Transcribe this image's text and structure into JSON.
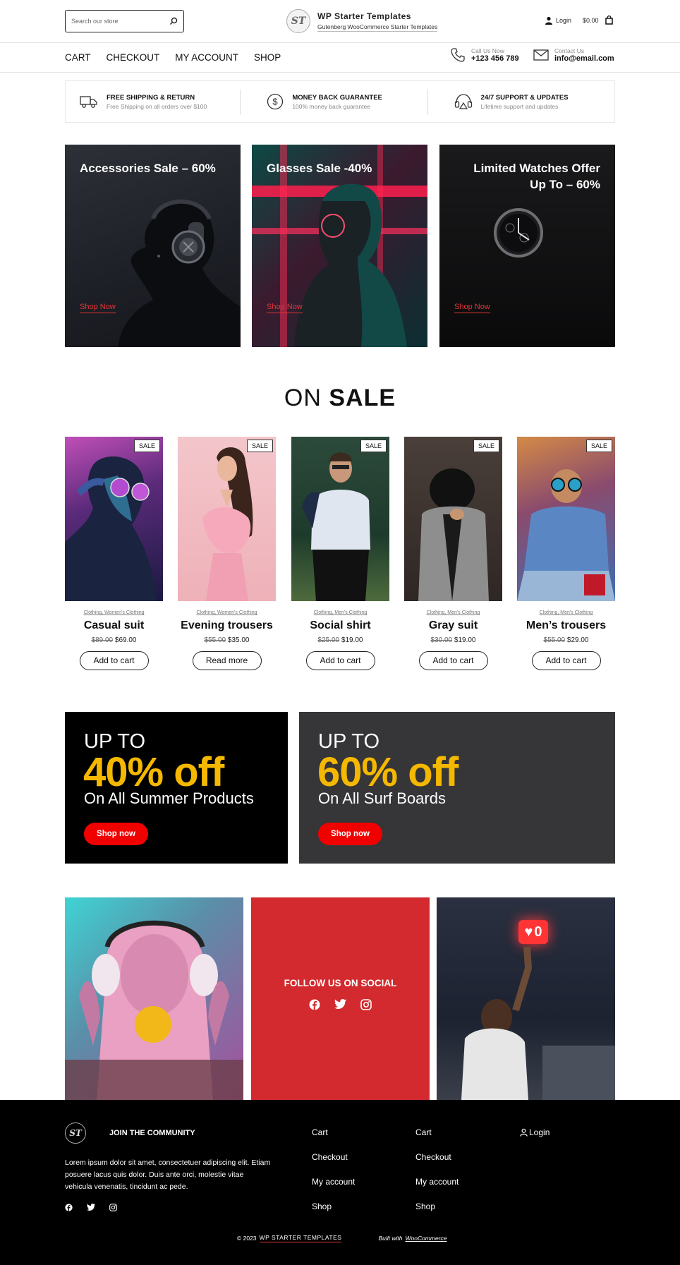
{
  "header": {
    "search_placeholder": "Search our store",
    "brand_title": "WP Starter Templates",
    "brand_subtitle": "Gutenberg WooCommerce Starter Templates",
    "logo_text": "ST",
    "login_label": "Login",
    "cart_total": "$0.00"
  },
  "nav": {
    "items": [
      "CART",
      "CHECKOUT",
      "MY ACCOUNT",
      "SHOP"
    ]
  },
  "contact": {
    "call_label": "Call Us Now",
    "phone": "+123 456 789",
    "mail_label": "Contact Us",
    "email": "info@email.com"
  },
  "features": [
    {
      "title": "FREE SHIPPING & RETURN",
      "sub": "Free Shipping on all orders over $100",
      "icon": "truck-icon"
    },
    {
      "title": "MONEY BACK GUARANTEE",
      "sub": "100% money back guarantee",
      "icon": "dollar-icon"
    },
    {
      "title": "24/7 SUPPORT & UPDATES",
      "sub": "Lifetime support and updates",
      "icon": "support-icon"
    }
  ],
  "banners": [
    {
      "title": "Accessories Sale – 60%",
      "link": "Shop Now"
    },
    {
      "title": "Glasses Sale -40%",
      "link": "Shop Now"
    },
    {
      "title_line1": "Limited Watches Offer",
      "title_line2": "Up To – 60%",
      "link": "Shop Now"
    }
  ],
  "onsale": {
    "light": "ON",
    "bold": "SALE"
  },
  "products": [
    {
      "badge": "SALE",
      "cat1": "Clothing",
      "cat2": "Women's Clothing",
      "name": "Casual suit",
      "old_price": "$89.00",
      "price": "$69.00",
      "button": "Add to cart"
    },
    {
      "badge": "SALE",
      "cat1": "Clothing",
      "cat2": "Women's Clothing",
      "name": "Evening trousers",
      "old_price": "$55.00",
      "price": "$35.00",
      "button": "Read more"
    },
    {
      "badge": "SALE",
      "cat1": "Clothing",
      "cat2": "Men's Clothing",
      "name": "Social shirt",
      "old_price": "$25.00",
      "price": "$19.00",
      "button": "Add to cart"
    },
    {
      "badge": "SALE",
      "cat1": "Clothing",
      "cat2": "Men's Clothing",
      "name": "Gray suit",
      "old_price": "$30.00",
      "price": "$19.00",
      "button": "Add to cart"
    },
    {
      "badge": "SALE",
      "cat1": "Clothing",
      "cat2": "Men's Clothing",
      "name": "Men’s trousers",
      "old_price": "$55.00",
      "price": "$29.00",
      "button": "Add to cart"
    }
  ],
  "promos": [
    {
      "up": "UP TO",
      "off": "40% off",
      "on": "On All Summer Products",
      "button": "Shop now"
    },
    {
      "up": "UP TO",
      "off": "60% off",
      "on": "On All Surf Boards",
      "button": "Shop now"
    }
  ],
  "social": {
    "title": "FOLLOW US ON SOCIAL",
    "notif_count": "0"
  },
  "footer": {
    "logo_text": "ST",
    "join": "JOIN THE COMMUNITY",
    "about": "Lorem ipsum dolor sit amet, consectetuer adipiscing elit. Etiam posuere lacus quis dolor. Duis ante orci, molestie vitae vehicula venenatis, tincidunt ac pede.",
    "col1": [
      "Cart",
      "Checkout",
      "My account",
      "Shop"
    ],
    "col2": [
      "Cart",
      "Checkout",
      "My account",
      "Shop"
    ],
    "login": "Login",
    "copyright": "© 2023",
    "brand_link": "WP STARTER TEMPLATES",
    "built_with": "Built with",
    "woo": "WooCommerce"
  },
  "colors": {
    "accent_red": "#f10000",
    "promo_yellow": "#f5b800",
    "social_red": "#d22a2e",
    "footer_bg": "#000000"
  }
}
